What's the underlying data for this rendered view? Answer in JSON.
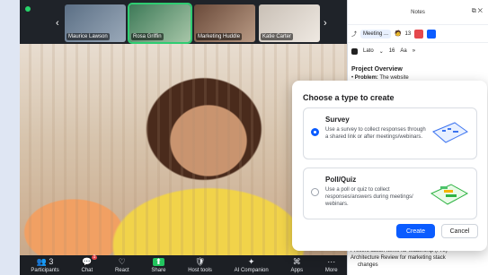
{
  "meeting": {
    "participants_tiles": [
      {
        "name": "Maurice Lawson",
        "active": false
      },
      {
        "name": "Rosa Griffin",
        "active": true
      },
      {
        "name": "Marketing Huddle",
        "active": false
      },
      {
        "name": "Katie Carter",
        "active": false
      }
    ],
    "arrows": {
      "left": "‹",
      "right": "›"
    },
    "toolbar": [
      {
        "label": "Participants",
        "icon": "participants-icon",
        "glyph": "👥",
        "extra": "3"
      },
      {
        "label": "Chat",
        "icon": "chat-icon",
        "glyph": "💬",
        "badge": "1"
      },
      {
        "label": "React",
        "icon": "react-icon",
        "glyph": "♡"
      },
      {
        "label": "Share",
        "icon": "share-icon",
        "glyph": "⬆"
      },
      {
        "label": "Host tools",
        "icon": "shield-icon",
        "glyph": "🛡"
      },
      {
        "label": "AI Companion",
        "icon": "ai-companion-icon",
        "glyph": "✦"
      },
      {
        "label": "Apps",
        "icon": "apps-icon",
        "glyph": "⌘"
      },
      {
        "label": "More",
        "icon": "more-icon",
        "glyph": "⋯"
      }
    ]
  },
  "notes": {
    "title": "Notes",
    "meeting_label": "Meeting ...",
    "count": "13",
    "font": "Lato",
    "font_size": "16",
    "text_style": "Aa",
    "heading": "Project Overview",
    "problem_label": "Problem:",
    "problem_text": "The website",
    "footer_lines": [
      "Present action items for leadership (FRI)",
      "Architecture Review for marketing stack",
      "changes"
    ]
  },
  "dialog": {
    "title": "Choose a type to create",
    "options": [
      {
        "title": "Survey",
        "desc": "Use a survey to collect responses through a shared link or after meetings/webinars.",
        "selected": true
      },
      {
        "title": "Poll/Quiz",
        "desc": "Use a poll or quiz to collect responses/answers during meetings/ webinars.",
        "selected": false
      }
    ],
    "create_label": "Create",
    "cancel_label": "Cancel"
  },
  "colors": {
    "accent": "#0b5cff",
    "active_tile": "#2ecc71",
    "badge": "#e5484d"
  }
}
